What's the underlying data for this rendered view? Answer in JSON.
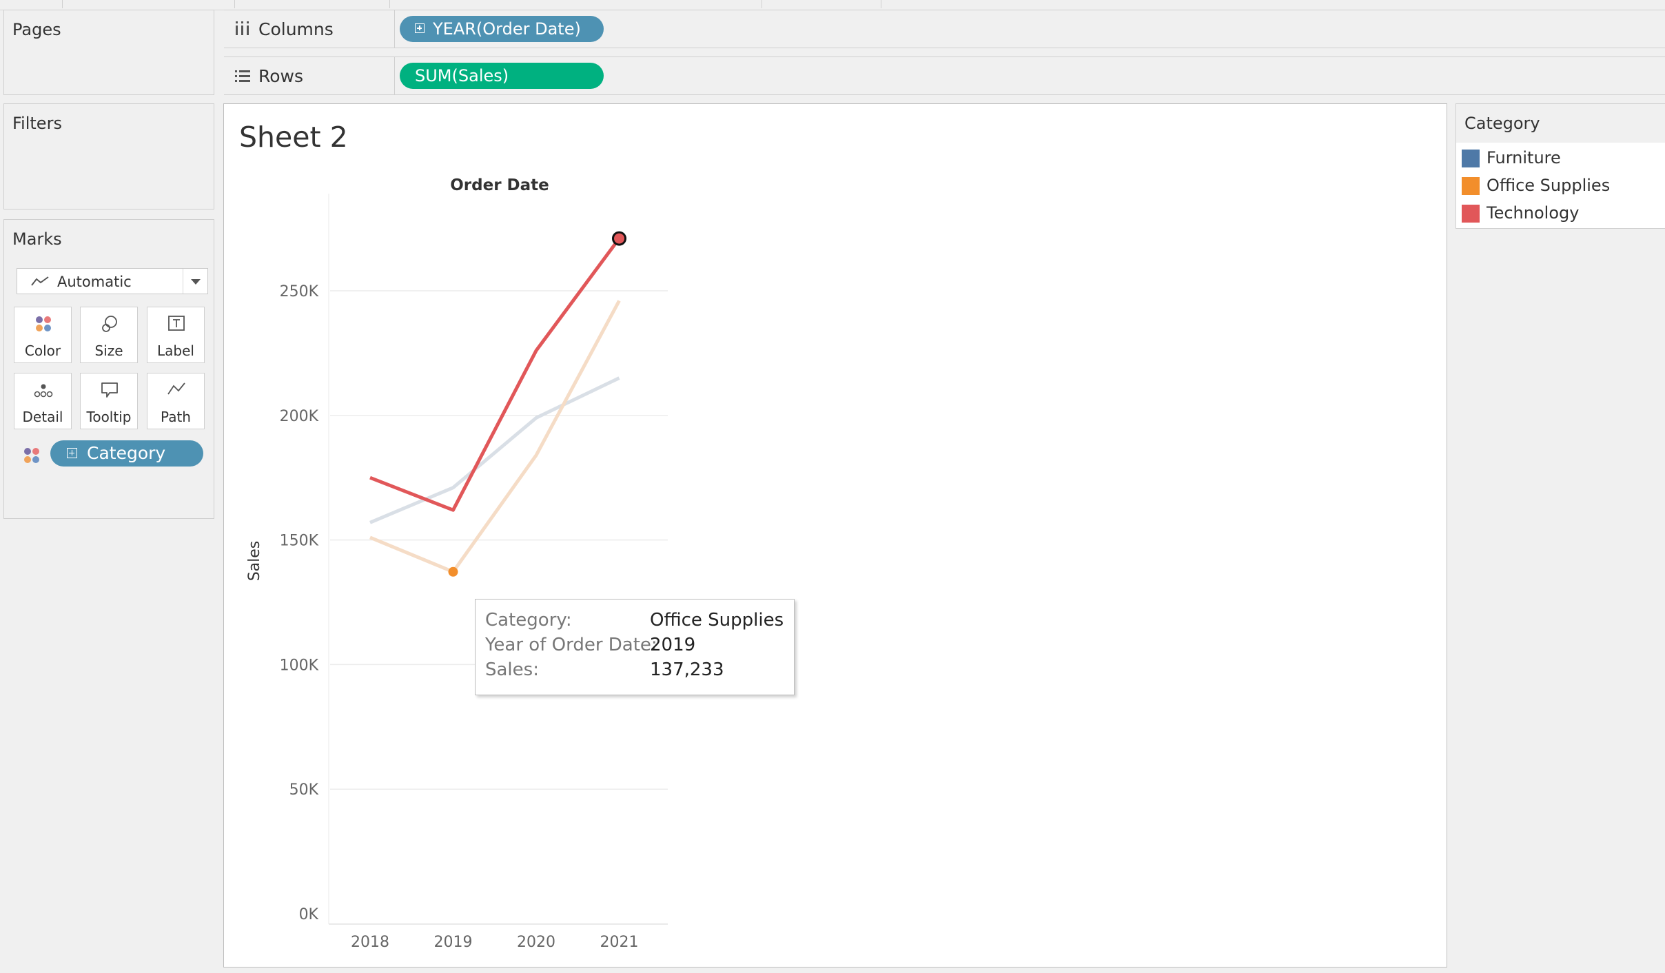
{
  "shelves": {
    "pages_label": "Pages",
    "filters_label": "Filters",
    "columns_label": "Columns",
    "columns_pill": "YEAR(Order Date)",
    "rows_label": "Rows",
    "rows_pill": "SUM(Sales)"
  },
  "marks": {
    "title": "Marks",
    "mark_type": "Automatic",
    "buttons": [
      "Color",
      "Size",
      "Label",
      "Detail",
      "Tooltip",
      "Path"
    ],
    "color_field": "Category"
  },
  "sheet": {
    "title": "Sheet 2"
  },
  "legend": {
    "title": "Category",
    "items": [
      {
        "name": "Furniture",
        "color": "#4e79a7"
      },
      {
        "name": "Office Supplies",
        "color": "#f28e2b"
      },
      {
        "name": "Technology",
        "color": "#e15759"
      }
    ]
  },
  "tooltip": {
    "rows": [
      {
        "key": "Category:",
        "value": "Office Supplies"
      },
      {
        "key": "Year of Order Date:",
        "value": "2019"
      },
      {
        "key": "Sales:",
        "value": "137,233"
      }
    ]
  },
  "colors": {
    "columns_pill": "#4e92b3",
    "rows_pill": "#00b180",
    "furniture_faded": "#d9dfe6",
    "office_faded": "#f5dcc6",
    "technology": "#e15759",
    "office_point": "#f28e2b"
  },
  "chart_data": {
    "type": "line",
    "title": "Order Date",
    "xlabel": "Order Date",
    "ylabel": "Sales",
    "categories": [
      "2018",
      "2019",
      "2020",
      "2021"
    ],
    "ylim": [
      0,
      290000
    ],
    "yticks": [
      0,
      50000,
      100000,
      150000,
      200000,
      250000
    ],
    "ytick_labels": [
      "0K",
      "50K",
      "100K",
      "150K",
      "200K",
      "250K"
    ],
    "series": [
      {
        "name": "Furniture",
        "values": [
          157000,
          171000,
          199000,
          215000
        ]
      },
      {
        "name": "Office Supplies",
        "values": [
          151000,
          137233,
          184000,
          246000
        ]
      },
      {
        "name": "Technology",
        "values": [
          175000,
          162000,
          226000,
          271000
        ]
      }
    ],
    "highlighted_series": "Technology",
    "selected_point": {
      "series": "Office Supplies",
      "category": "2019"
    },
    "grid": true
  }
}
